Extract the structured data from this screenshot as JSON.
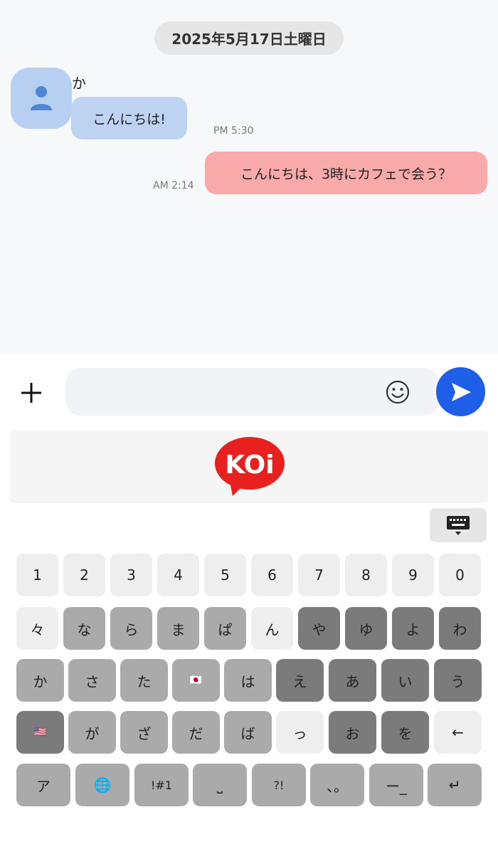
{
  "chat": {
    "date": "2025年5月17日土曜日",
    "incoming": {
      "sender": "か",
      "text": "こんにちは!",
      "time": "PM 5:30"
    },
    "outgoing": {
      "text": "こんにちは、3時にカフェで会う？",
      "time": "AM 2:14"
    }
  },
  "input": {
    "placeholder": "",
    "value": ""
  },
  "banner": {
    "logo_text": "KOi"
  },
  "keyboard": {
    "numbers": [
      "1",
      "2",
      "3",
      "4",
      "5",
      "6",
      "7",
      "8",
      "9",
      "0"
    ],
    "row1": [
      "々",
      "な",
      "ら",
      "ま",
      "ぱ",
      "ん",
      "や",
      "ゆ",
      "よ",
      "わ"
    ],
    "row2": [
      "か",
      "さ",
      "た",
      "🇯🇵",
      "は",
      "え",
      "あ",
      "い",
      "う"
    ],
    "row3": [
      "🇺🇸",
      "が",
      "ざ",
      "だ",
      "ば",
      "っ",
      "お",
      "を",
      "←"
    ],
    "row4": [
      "ア",
      "🌐",
      "!#1",
      "⎵",
      "?!",
      "、。",
      "ー_",
      "↵"
    ]
  },
  "colors": {
    "accent": "#1f5ee8",
    "incoming_bubble": "#bed2f2",
    "outgoing_bubble": "#f8a9aa",
    "logo_red": "#e8201f"
  }
}
